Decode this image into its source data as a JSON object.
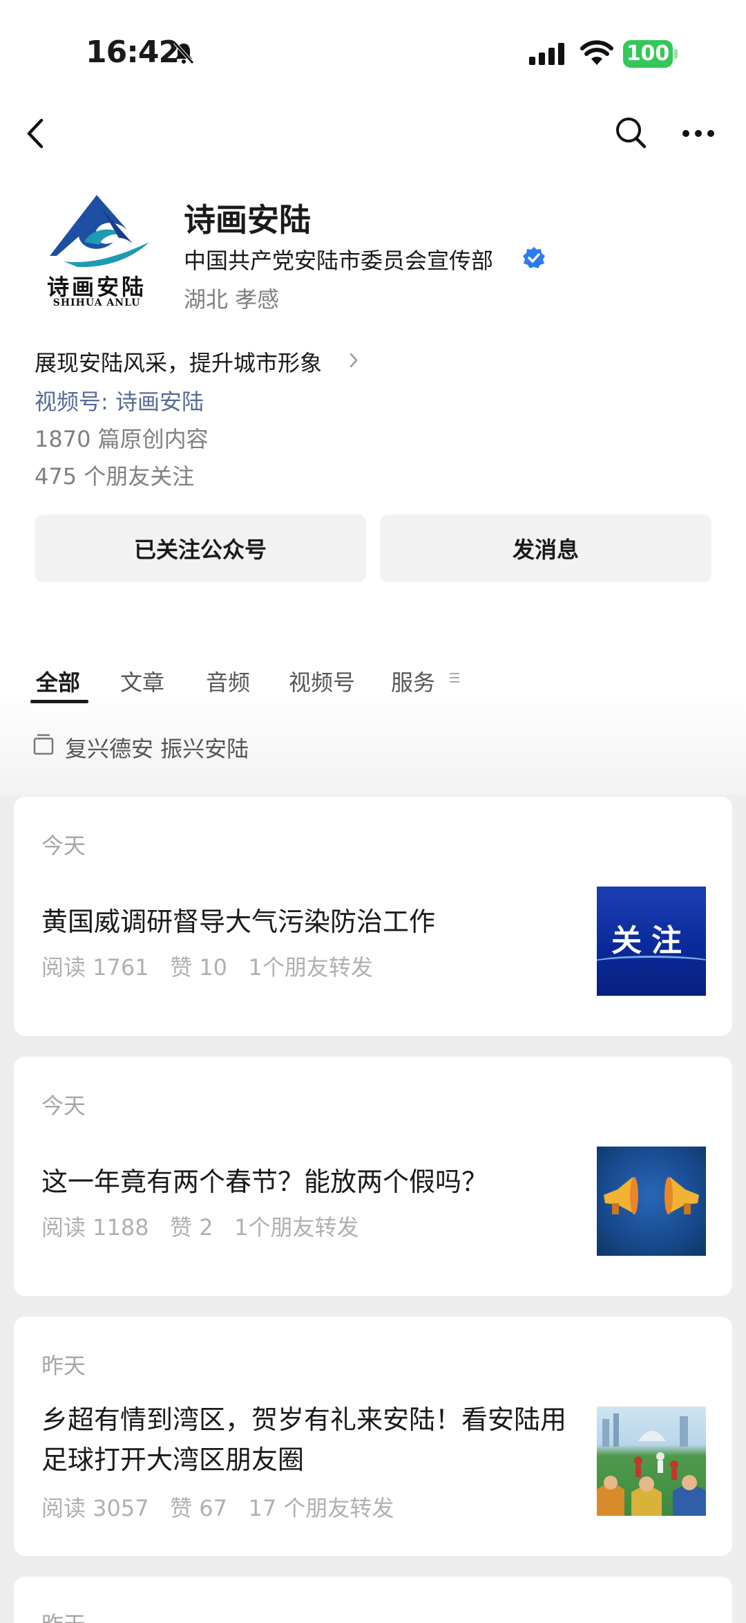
{
  "status_bar": {
    "time": "16:42",
    "battery": "100"
  },
  "nav": {
    "back_icon": "chevron-left-icon",
    "search_icon": "search-icon",
    "more_icon": "more-horizontal-icon"
  },
  "profile": {
    "logo_caption": "诗画安陆",
    "logo_caption_en": "SHIHUA ANLU",
    "name": "诗画安陆",
    "owner": "中国共产党安陆市委员会宣传部",
    "location": "湖北 孝感",
    "description": "展现安陆风采，提升城市形象",
    "channel_link": "视频号: 诗画安陆",
    "original_count": "1870 篇原创内容",
    "friends_following": "475 个朋友关注"
  },
  "actions": {
    "follow_label": "已关注公众号",
    "message_label": "发消息"
  },
  "tabs": [
    {
      "label": "全部",
      "active": true
    },
    {
      "label": "文章",
      "active": false
    },
    {
      "label": "音频",
      "active": false
    },
    {
      "label": "视频号",
      "active": false
    },
    {
      "label": "服务",
      "active": false
    }
  ],
  "album": {
    "label": "复兴德安 振兴安陆"
  },
  "articles": [
    {
      "date": "今天",
      "title": "黄国威调研督导大气污染防治工作",
      "meta": "阅读 1761   赞 10   1个朋友转发",
      "thumb_text": "关注"
    },
    {
      "date": "今天",
      "title": "这一年竟有两个春节？能放两个假吗？",
      "meta": "阅读 1188   赞 2   1个朋友转发"
    },
    {
      "date": "昨天",
      "title": "乡超有情到湾区，贺岁有礼来安陆！看安陆用足球打开大湾区朋友圈",
      "meta": "阅读 3057   赞 67   17 个朋友转发"
    },
    {
      "date": "昨天"
    }
  ],
  "colors": {
    "link": "#576b95",
    "verified": "#2b7cf0",
    "battery": "#34c759",
    "logo_blue": "#1f4fa3",
    "logo_teal": "#1d9bb2"
  }
}
